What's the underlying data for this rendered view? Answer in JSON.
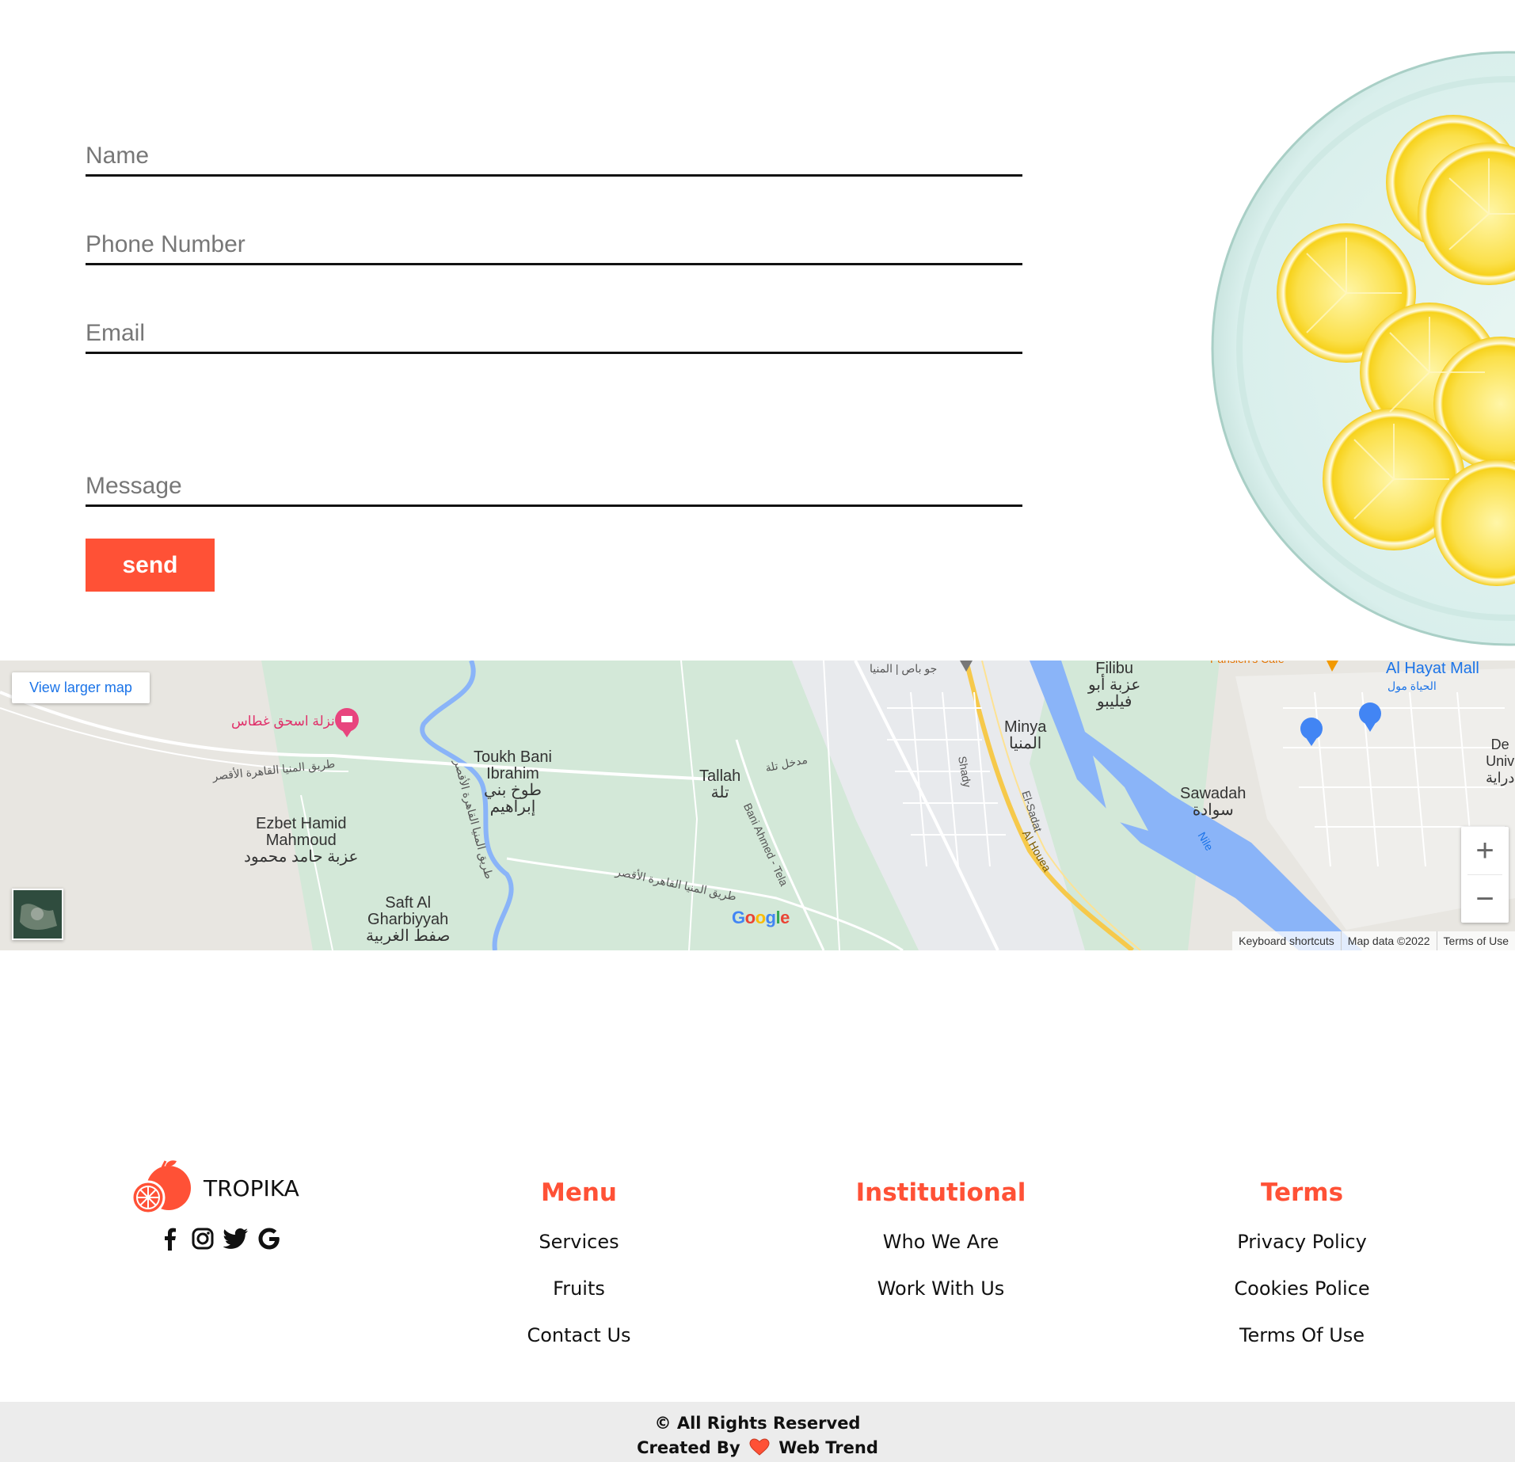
{
  "form": {
    "name_placeholder": "Name",
    "phone_placeholder": "Phone Number",
    "email_placeholder": "Email",
    "message_placeholder": "Message",
    "send_label": "send"
  },
  "map": {
    "view_larger_label": "View larger map",
    "zoom_in_label": "+",
    "zoom_out_label": "−",
    "footer": {
      "keyboard": "Keyboard shortcuts",
      "data": "Map data ©2022",
      "terms": "Terms of Use"
    },
    "google_logo": [
      "G",
      "o",
      "o",
      "g",
      "l",
      "e"
    ],
    "labels": {
      "toukh": "Toukh Bani\nIbrahim\nطوخ بني\nإبراهيم",
      "tallah": "Tallah\nتلة",
      "ezbet": "Ezbet Hamid\nMahmoud\nعزبة حامد محمود",
      "saft": "Saft Al\nGharbiyyah\nصفط الغربية",
      "minya": "Minya\nالمنيا",
      "filibu": "Filibu\nعزبة أبو\nفيليبو",
      "sawadah": "Sawadah\nسوادة",
      "hayat_en": "Al Hayat Mall",
      "hayat_ar": "الحياة مول",
      "nazla": "نزلة اسحق غطاس",
      "road1": "طريق المنيا القاهرة الأقصر",
      "road2": "طريق المنيا القاهرة الأقصر",
      "road3": "طريق المنيا القاهرة الأقصر",
      "madkhal": "مدخل تلة",
      "shady": "Shady",
      "elsadat": "El-Sadat",
      "alhouea": "Al Houea",
      "bani_ahmed": "Bani Ahmed - Tela",
      "nile": "Nile",
      "jew": "جو باص | المنيا",
      "de": "De\nUniv\nدراية",
      "parisiens": "Parisien's Cafe"
    }
  },
  "footer": {
    "brand": "TROPIKA",
    "social": [
      "facebook-icon",
      "instagram-icon",
      "twitter-icon",
      "google-icon"
    ],
    "columns": [
      {
        "title": "Menu",
        "links": [
          "Services",
          "Fruits",
          "Contact Us"
        ]
      },
      {
        "title": "Institutional",
        "links": [
          "Who We Are",
          "Work With Us"
        ]
      },
      {
        "title": "Terms",
        "links": [
          "Privacy Policy",
          "Cookies Police",
          "Terms Of Use"
        ]
      }
    ],
    "rights": "© All Rights Reserved",
    "created_prefix": "Created By",
    "created_name": "Web Trend"
  },
  "colors": {
    "accent": "#ff5136",
    "river": "#8ab4f8",
    "green_area": "#d3e8d8"
  }
}
